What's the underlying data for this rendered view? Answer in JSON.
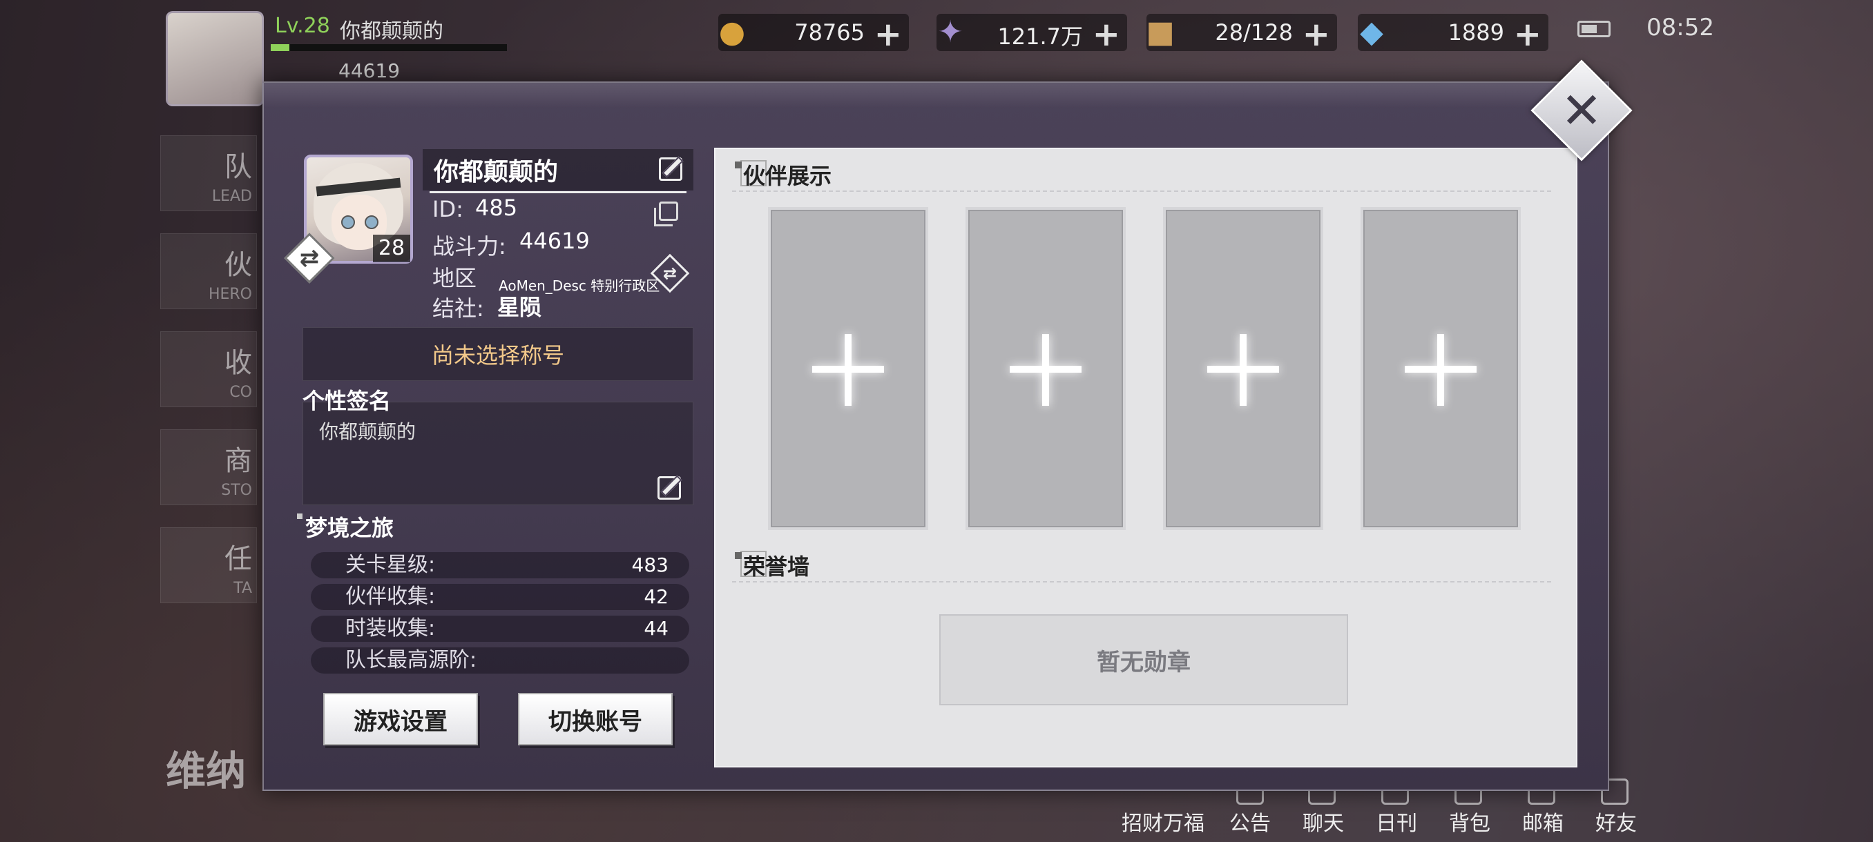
{
  "topbar": {
    "level": "Lv.28",
    "player_name": "你都颠颠的",
    "xp_fraction": 0.08,
    "power": "44619",
    "resources": [
      {
        "icon": "coin-icon",
        "value": "78765"
      },
      {
        "icon": "crystal-icon",
        "value": "121.7万"
      },
      {
        "icon": "bread-icon",
        "value": "28/128"
      },
      {
        "icon": "diamond-icon",
        "value": "1889"
      }
    ],
    "plus": "+",
    "time": "08:52"
  },
  "side_menu": [
    {
      "t1": "队",
      "t2": "LEAD"
    },
    {
      "t1": "伙",
      "t2": "HERO"
    },
    {
      "t1": "收",
      "t2": "CO"
    },
    {
      "t1": "商",
      "t2": "STO"
    },
    {
      "t1": "任",
      "t2": "TA"
    }
  ],
  "bottom_nav": [
    "招财万福",
    "公告",
    "聊天",
    "日刊",
    "背包",
    "邮箱",
    "好友"
  ],
  "venus_text": "维纳",
  "profile": {
    "name": "你都颠颠的",
    "level": "28",
    "id_label": "ID:",
    "id_value": "485",
    "power_label": "战斗力:",
    "power_value": "44619",
    "region_label": "地区",
    "region_value": "AoMen_Desc 特别行政区",
    "alliance_label": "结社:",
    "alliance_value": "星陨",
    "title_button": "尚未选择称号",
    "signature_label": "个性签名",
    "signature_text": "你都颠颠的"
  },
  "journey": {
    "title": "梦境之旅",
    "stats": [
      {
        "label": "关卡星级:",
        "value": "483"
      },
      {
        "label": "伙伴收集:",
        "value": "42"
      },
      {
        "label": "时装收集:",
        "value": "44"
      },
      {
        "label": "队长最高源阶:",
        "value": ""
      }
    ]
  },
  "buttons": {
    "settings": "游戏设置",
    "switch_account": "切换账号"
  },
  "partners": {
    "title": "伙伴展示",
    "slots": 4
  },
  "honor": {
    "title": "荣誉墙",
    "empty": "暂无勋章"
  },
  "colors": {
    "accent_gold": "#f3c98a",
    "level_green": "#8fd15a",
    "modal_bg": "#4b4258",
    "panel_bg": "#e4e4e6"
  }
}
